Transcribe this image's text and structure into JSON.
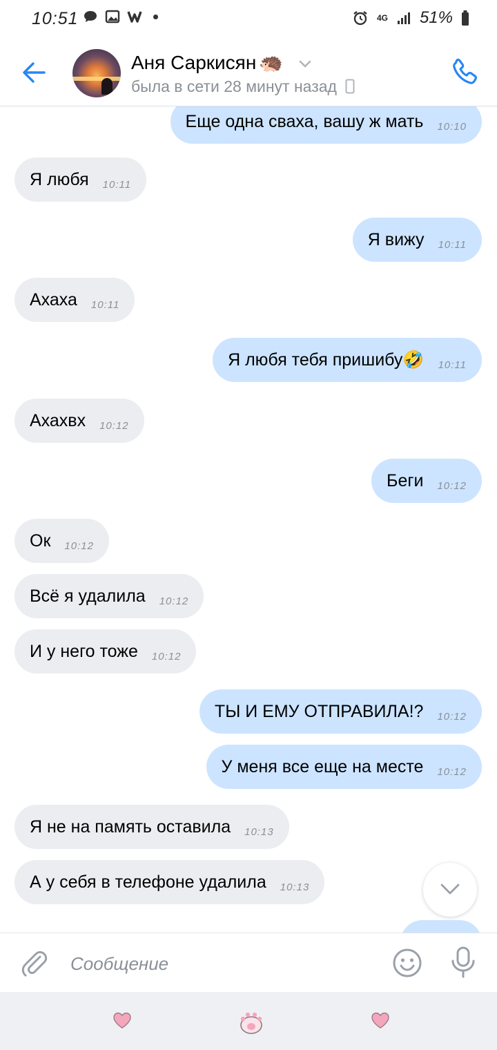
{
  "status_bar": {
    "time": "10:51",
    "network": "4G",
    "battery": "51%"
  },
  "header": {
    "back_label": "Back",
    "contact_name": "Аня Саркисян",
    "name_emoji": "🦔",
    "last_seen": "была в сети 28 минут назад"
  },
  "messages": [
    {
      "dir": "out",
      "text": "Еще одна сваха, вашу ж мать",
      "time": "10:10"
    },
    {
      "dir": "in",
      "text": "Я любя",
      "time": "10:11"
    },
    {
      "dir": "out",
      "text": "Я вижу",
      "time": "10:11"
    },
    {
      "dir": "in",
      "text": "Ахаха",
      "time": "10:11"
    },
    {
      "dir": "out",
      "text": "Я любя тебя пришибу🤣",
      "time": "10:11"
    },
    {
      "dir": "in",
      "text": "Ахахвх",
      "time": "10:12"
    },
    {
      "dir": "out",
      "text": "Беги",
      "time": "10:12"
    },
    {
      "dir": "in",
      "text": "Ок",
      "time": "10:12"
    },
    {
      "dir": "in",
      "text": "Всё я удалила",
      "time": "10:12"
    },
    {
      "dir": "in",
      "text": "И у него тоже",
      "time": "10:12"
    },
    {
      "dir": "out",
      "text": "ТЫ И ЕМУ ОТПРАВИЛА!?",
      "time": "10:12"
    },
    {
      "dir": "out",
      "text": "У меня все еще на месте",
      "time": "10:12"
    },
    {
      "dir": "in",
      "text": "Я  не на память оставила",
      "time": "10:13"
    },
    {
      "dir": "in",
      "text": "А у себя в телефоне удалила",
      "time": "10:13"
    }
  ],
  "composer": {
    "placeholder": "Сообщение"
  },
  "colors": {
    "accent": "#2787f5",
    "bubble_in": "#ebedf0",
    "bubble_out": "#cce4ff",
    "nav_heart": "#f4a6bd"
  }
}
